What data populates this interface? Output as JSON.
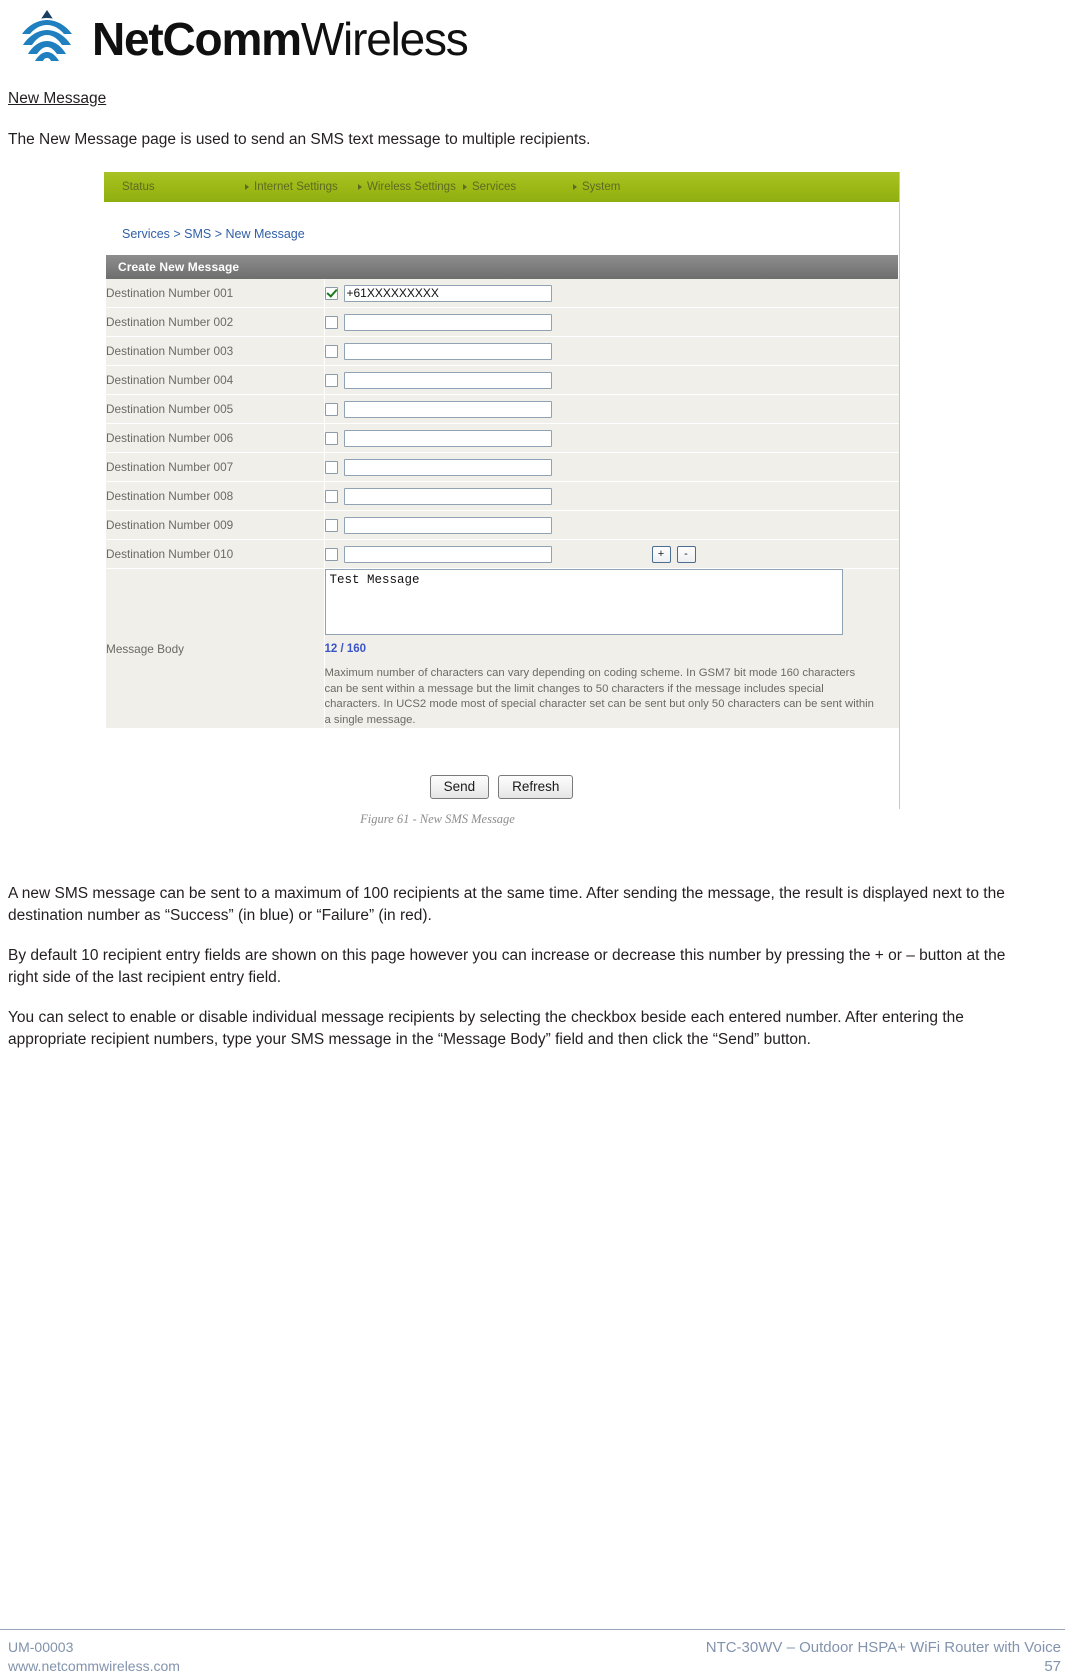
{
  "brand": {
    "name_bold": "NetComm",
    "name_light": "Wireless",
    "logo_icon": "wireless-signal-icon"
  },
  "document": {
    "section_title": "New Message",
    "intro": "The New Message page is used to send an SMS text message to multiple recipients.",
    "paragraphs": [
      "A new SMS message can be sent to a maximum of 100 recipients at the same time. After sending the message, the result is displayed next to the destination number as “Success” (in blue) or “Failure” (in red).",
      "By default 10 recipient entry fields are shown on this page however you can increase or decrease this number by pressing the + or – button at the right side of the last recipient entry field.",
      "You can select to enable or disable individual message recipients by selecting the checkbox beside each entered number. After entering the appropriate recipient numbers, type your SMS message in the “Message Body” field and then click the “Send” button."
    ],
    "figure_caption": "Figure 61 - New SMS Message"
  },
  "screenshot": {
    "nav": [
      {
        "label": "Status",
        "has_arrow": false
      },
      {
        "label": "Internet Settings",
        "has_arrow": true
      },
      {
        "label": "Wireless Settings",
        "has_arrow": true
      },
      {
        "label": "Services",
        "has_arrow": true
      },
      {
        "label": "System",
        "has_arrow": true
      }
    ],
    "breadcrumb": "Services > SMS > New Message",
    "panel_title": "Create New Message",
    "rows": [
      {
        "label": "Destination Number 001",
        "checked": true,
        "value": "+61XXXXXXXXX"
      },
      {
        "label": "Destination Number 002",
        "checked": false,
        "value": ""
      },
      {
        "label": "Destination Number 003",
        "checked": false,
        "value": ""
      },
      {
        "label": "Destination Number 004",
        "checked": false,
        "value": ""
      },
      {
        "label": "Destination Number 005",
        "checked": false,
        "value": ""
      },
      {
        "label": "Destination Number 006",
        "checked": false,
        "value": ""
      },
      {
        "label": "Destination Number 007",
        "checked": false,
        "value": ""
      },
      {
        "label": "Destination Number 008",
        "checked": false,
        "value": ""
      },
      {
        "label": "Destination Number 009",
        "checked": false,
        "value": ""
      },
      {
        "label": "Destination Number 010",
        "checked": false,
        "value": ""
      }
    ],
    "add_button": "+",
    "remove_button": "-",
    "message_body_label": "Message Body",
    "message_body_value": "Test Message",
    "character_counter": "12 / 160",
    "help_text": "Maximum number of characters can vary depending on coding scheme. In GSM7 bit mode 160 characters can be sent within a message but the limit changes to 50 characters if the message includes special characters. In UCS2 mode most of special character set can be sent but only 50 characters can be sent within a single message.",
    "send_button": "Send",
    "refresh_button": "Refresh"
  },
  "footer": {
    "doc_id": "UM-00003",
    "website": "www.netcommwireless.com",
    "product": "NTC-30WV – Outdoor HSPA+ WiFi Router with Voice",
    "page_number": "57"
  }
}
